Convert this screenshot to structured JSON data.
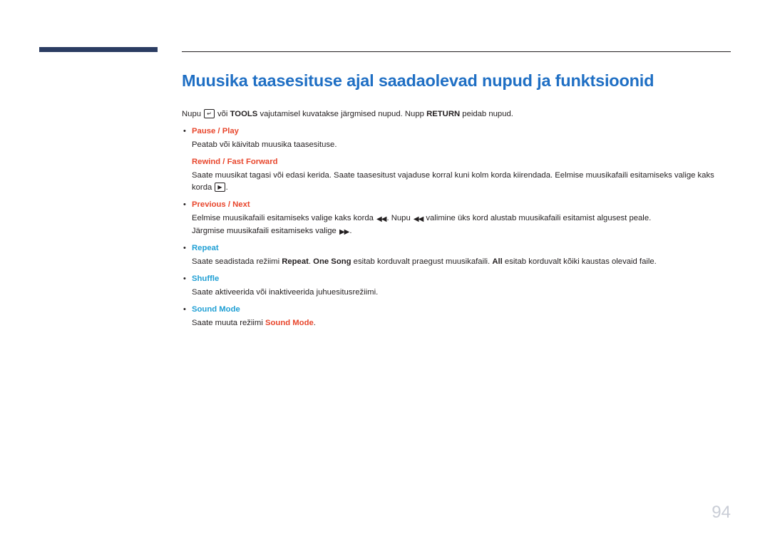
{
  "document": {
    "title": "Muusika taasesituse ajal saadaolevad nupud ja funktsioonid",
    "page_number": "94",
    "intro": {
      "part1": "Nupu",
      "enter_key": "↵",
      "part2": "või",
      "tools": "TOOLS",
      "part3": "vajutamisel kuvatakse järgmised nupud. Nupp",
      "return": "RETURN",
      "part4": "peidab nupud."
    },
    "items": [
      {
        "bullet": "•",
        "heading": "Pause / Play",
        "heading_color": "#e8462c",
        "lines": [
          {
            "text": "Peatab või käivitab muusika taasesituse."
          }
        ]
      },
      {
        "bullet": "",
        "heading": "Rewind / Fast Forward",
        "heading_color": "#e8462c",
        "lines": [
          {
            "text": "Saate muusikat tagasi või edasi kerida. Saate taasesitust vajaduse korral kuni kolm korda kiirendada. Eelmise muusikafaili esitamiseks valige kaks korda",
            "suffix_glyph": "▶",
            "suffix_text": "."
          }
        ]
      },
      {
        "bullet": "•",
        "heading": "Previous / Next",
        "heading_color": "#e8462c",
        "lines": [
          {
            "prefix": "Eelmise muusikafaili esitamiseks valige kaks korda",
            "glyph1": "◀◀",
            "middle": ". Nupu",
            "glyph2": "◀◀",
            "suffix": "valimine üks kord alustab muusikafaili esitamist algusest peale."
          },
          {
            "prefix2": "Järgmise muusikafaili esitamiseks valige",
            "glyph3": "▶▶",
            "suffix2": "."
          }
        ]
      },
      {
        "bullet": "•",
        "heading": "Repeat",
        "heading_color": "#1f9fd4",
        "lines": [
          {
            "p1": "Saate seadistada režiimi",
            "b1": "Repeat",
            "p2": ".",
            "b2": "One Song",
            "p3": "esitab korduvalt praegust muusikafaili.",
            "b3": "All",
            "p4": "esitab korduvalt kõiki kaustas olevaid faile."
          }
        ]
      },
      {
        "bullet": "•",
        "heading": "Shuffle",
        "heading_color": "#1f9fd4",
        "lines": [
          {
            "text": "Saate aktiveerida või inaktiveerida juhuesitusrežiimi."
          }
        ]
      },
      {
        "bullet": "•",
        "heading": "Sound Mode",
        "heading_color": "#1f9fd4",
        "lines": [
          {
            "p1": "Saate muuta režiimi",
            "b1": "Sound Mode",
            "p2": "."
          }
        ]
      }
    ]
  }
}
